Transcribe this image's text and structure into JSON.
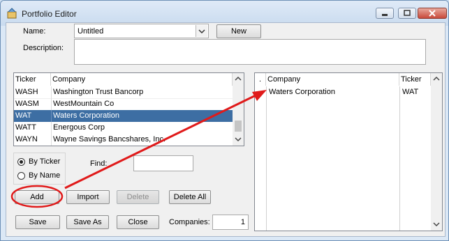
{
  "window": {
    "title": "Portfolio Editor",
    "icons": {
      "app": "app-icon",
      "minimize": "minimize-icon",
      "maximize": "maximize-icon",
      "close": "close-icon"
    }
  },
  "form": {
    "name_label": "Name:",
    "name_value": "Untitled",
    "new_label": "New",
    "description_label": "Description:",
    "description_value": ""
  },
  "search_list": {
    "headers": [
      "Ticker",
      "Company"
    ],
    "rows": [
      {
        "ticker": "WASH",
        "company": "Washington Trust Bancorp"
      },
      {
        "ticker": "WASM",
        "company": "WestMountain Co"
      },
      {
        "ticker": "WAT",
        "company": "Waters Corporation"
      },
      {
        "ticker": "WATT",
        "company": "Energous Corp"
      },
      {
        "ticker": "WAYN",
        "company": "Wayne Savings Bancshares, Inc."
      }
    ]
  },
  "sort": {
    "by_ticker": "By Ticker",
    "by_name": "By Name",
    "selected": "By Ticker"
  },
  "find": {
    "label": "Find:",
    "value": ""
  },
  "actions": {
    "add": "Add",
    "import": "Import",
    "delete": "Delete",
    "delete_all": "Delete All"
  },
  "footer": {
    "save": "Save",
    "save_as": "Save As",
    "close": "Close",
    "companies_label": "Companies:",
    "companies_count": "1"
  },
  "portfolio_list": {
    "headers": [
      ".",
      "Company",
      "Ticker"
    ],
    "rows": [
      {
        "company": "Waters Corporation",
        "ticker": "WAT"
      }
    ]
  },
  "colors": {
    "selection": "#3d6ea3",
    "annotation": "#e01a1a"
  }
}
